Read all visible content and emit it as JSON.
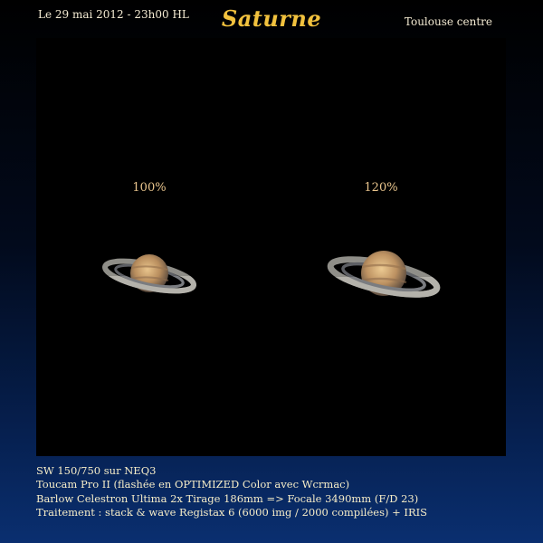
{
  "header": {
    "date": "Le 29 mai 2012 - 23h00 HL",
    "title": "Saturne",
    "location": "Toulouse centre"
  },
  "images": [
    {
      "zoom_label": "100%"
    },
    {
      "zoom_label": "120%"
    }
  ],
  "caption": {
    "lines": [
      "SW 150/750 sur NEQ3",
      "Toucam Pro II (flashée en OPTIMIZED Color avec Wcrmac)",
      "Barlow Celestron Ultima 2x Tirage 186mm => Focale 3490mm (F/D 23)",
      "Traitement : stack & wave Registax 6 (6000 img / 2000 compilées) + IRIS"
    ]
  }
}
